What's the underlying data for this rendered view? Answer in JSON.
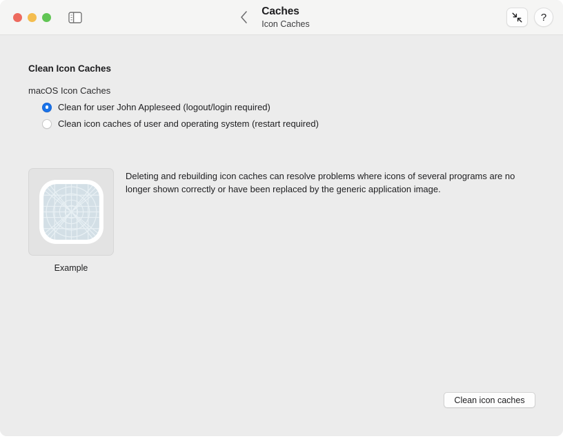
{
  "window": {
    "traffic_lights": {
      "close_color": "#ed6a5e",
      "minimize_color": "#f4bd4f",
      "zoom_color": "#61c554"
    },
    "title": "Caches",
    "subtitle": "Icon Caches",
    "back_label": "back-chevron",
    "sidebar_toggle_name": "sidebar-toggle-icon",
    "collapse_button_name": "collapse-arrows-icon",
    "help_button_label": "?"
  },
  "main": {
    "section_title": "Clean Icon Caches",
    "group_label": "macOS Icon Caches",
    "options": [
      {
        "label": "Clean for user John Appleseed (logout/login required)",
        "selected": true
      },
      {
        "label": "Clean icon caches of user and operating system (restart required)",
        "selected": false
      }
    ],
    "example": {
      "caption": "Example",
      "icon_name": "generic-application-icon"
    },
    "description": "Deleting and rebuilding icon caches can resolve problems where icons of several programs are no longer shown correctly or have been replaced by the generic application image.",
    "action_button": "Clean icon caches"
  },
  "colors": {
    "accent": "#1a73e8",
    "window_background": "#ececec",
    "titlebar_background": "#f5f5f4",
    "icon_fill": "#d3dfe6"
  }
}
